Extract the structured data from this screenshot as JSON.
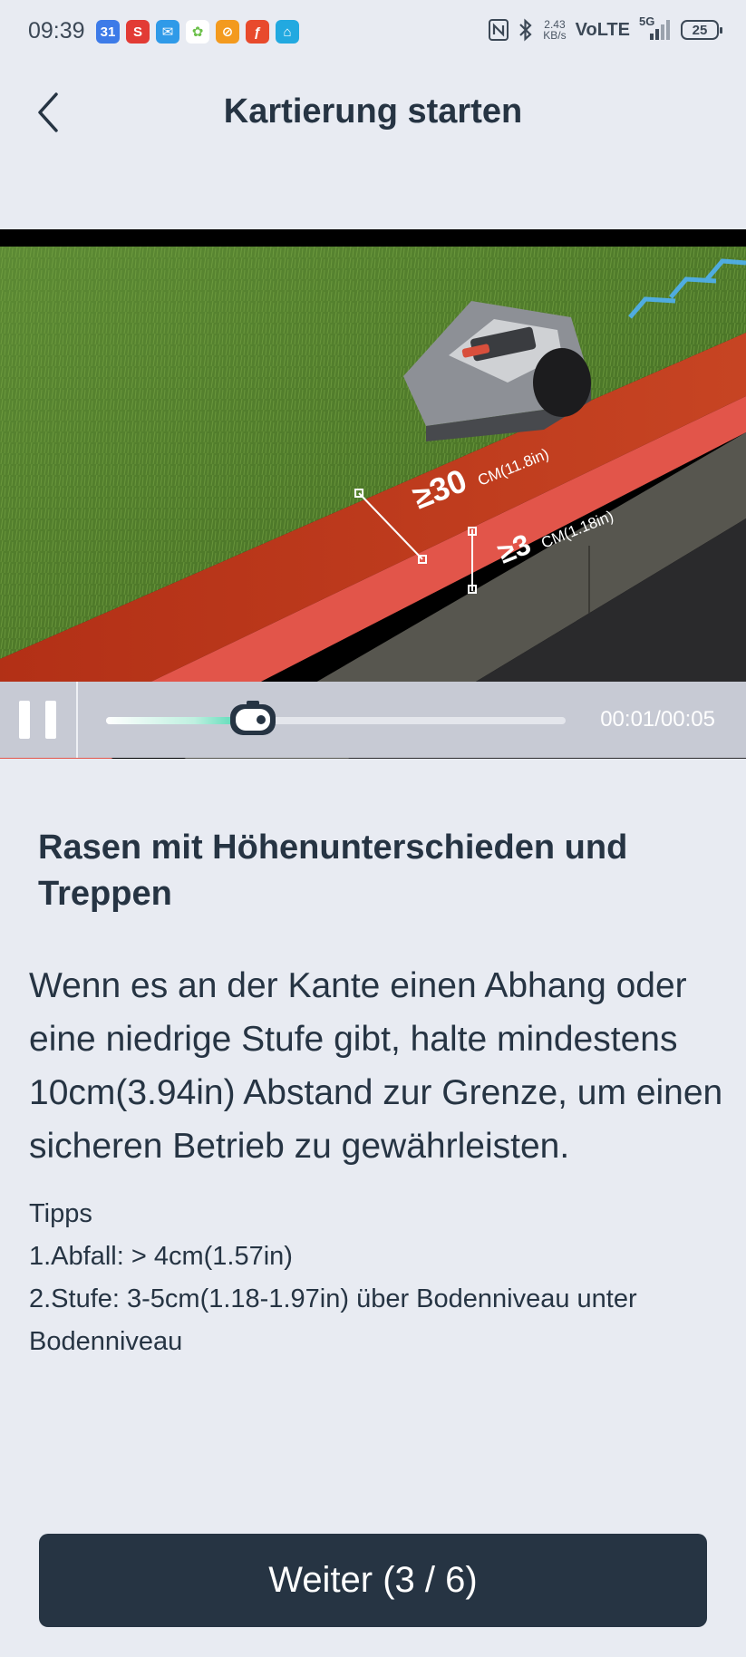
{
  "status_bar": {
    "time": "09:39",
    "notification_icons": [
      {
        "icon": "calendar-icon",
        "label": "31",
        "color": "#3d7be8"
      },
      {
        "icon": "s-app-icon",
        "label": "S",
        "color": "#e23b35"
      },
      {
        "icon": "mail-icon",
        "label": "✉",
        "color": "#2f9ae8"
      },
      {
        "icon": "photos-icon",
        "label": "✿",
        "color": "#6cc04a"
      },
      {
        "icon": "orange-app-icon",
        "label": "⊘",
        "color": "#f39a1e"
      },
      {
        "icon": "red-app-icon",
        "label": "ƒ",
        "color": "#e84a2c"
      },
      {
        "icon": "home-app-icon",
        "label": "⌂",
        "color": "#22a9e0"
      }
    ],
    "net_speed_value": "2.43",
    "net_speed_unit": "KB/s",
    "network": "VoLTE",
    "network_gen": "5G",
    "battery": "25"
  },
  "header": {
    "title": "Kartierung starten"
  },
  "video": {
    "overlay_gap_label": "≥30",
    "overlay_gap_unit": "CM(11.8in)",
    "overlay_step_label": "≥3",
    "overlay_step_unit": "CM(1.18in)",
    "time_readout": "00:01/00:05",
    "progress": 0.32
  },
  "content": {
    "heading": "Rasen mit Höhenunterschieden und Treppen",
    "description": "Wenn es an der Kante einen Abhang oder eine niedrige Stufe gibt, halte mindestens 10cm(3.94in) Abstand zur Grenze, um einen sicheren Betrieb zu gewährleisten.",
    "tips_title": "Tipps",
    "tips": [
      "1.Abfall: > 4cm(1.57in)",
      "2.Stufe: 3-5cm(1.18-1.97in) über Bodenniveau unter Bodenniveau"
    ]
  },
  "footer": {
    "next_label": "Weiter (3 / 6)"
  }
}
